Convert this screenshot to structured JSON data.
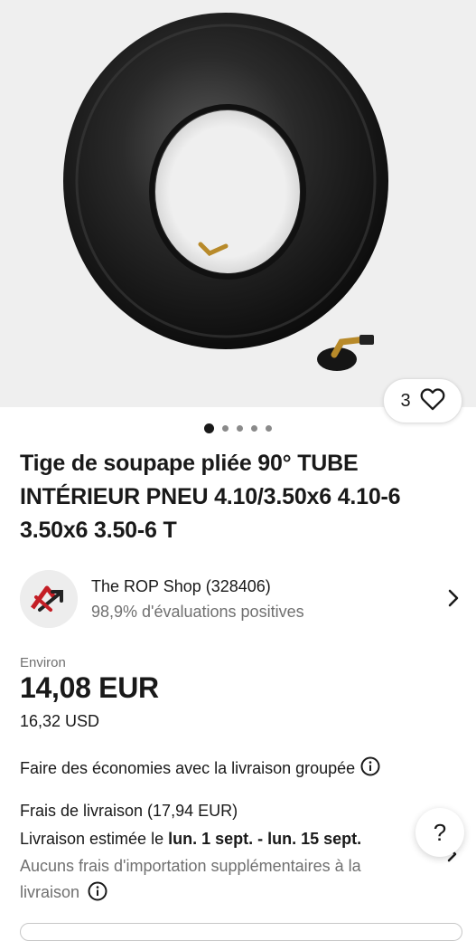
{
  "product": {
    "image_alt": "Chambre à air",
    "watchers_count": "3",
    "gallery": {
      "total": 5,
      "active_index": 0
    },
    "title": "Tige de soupape pliée 90° TUBE INTÉRIEUR PNEU 4.10/3.50x6 4.10-6 3.50x6 3.50-6 T"
  },
  "seller": {
    "name": "The ROP Shop (328406)",
    "feedback": "98,9% d'évaluations positives"
  },
  "price": {
    "approx_label": "Environ",
    "amount": "14,08 EUR",
    "converted": "16,32 USD"
  },
  "shipping": {
    "savings": "Faire des économies avec la livraison groupée",
    "cost": "Frais de livraison (17,94 EUR)",
    "estimate_prefix": "Livraison estimée le ",
    "estimate_dates": "lun. 1 sept. - lun. 15 sept.",
    "import_note": "Aucuns frais d'importation supplémentaires à la livraison"
  },
  "help": {
    "label": "?"
  },
  "colors": {
    "text": "#191919",
    "secondary": "#707070",
    "hero_bg": "#efefef",
    "accent": "#e53238"
  },
  "icons": [
    "heart-icon",
    "info-icon",
    "chevron-right-icon"
  ]
}
